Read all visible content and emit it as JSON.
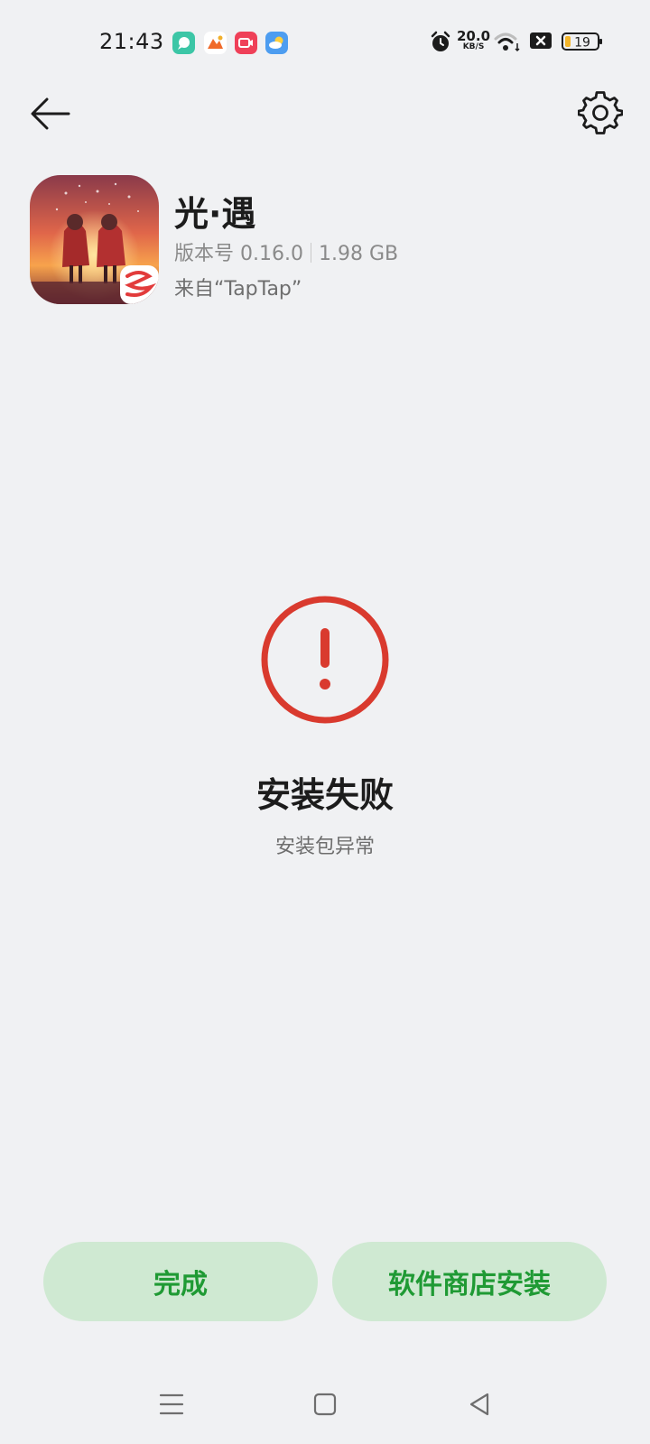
{
  "status_bar": {
    "time": "21:43",
    "notification_icons": [
      "chat-bubble-icon",
      "photo-gallery-icon",
      "video-recorder-icon",
      "weather-icon"
    ],
    "net_speed_value": "20.0",
    "net_speed_unit": "KB/S",
    "battery_level": "19",
    "icons": [
      "alarm-icon",
      "wifi-icon",
      "sim-off-icon",
      "battery-icon"
    ]
  },
  "header": {
    "back_icon": "arrow-left-icon",
    "settings_icon": "gear-icon"
  },
  "app": {
    "name": "光·遇",
    "version": "版本号 0.16.0",
    "size": "1.98 GB",
    "source": "来自“TapTap”"
  },
  "result": {
    "icon": "exclamation-circle-icon",
    "icon_color": "#d93a2e",
    "title": "安装失败",
    "subtitle": "安装包异常"
  },
  "actions": {
    "done_label": "完成",
    "store_install_label": "软件商店安装",
    "accent_color": "#1f9a34",
    "button_bg": "#cfe9d2"
  },
  "nav_bar": {
    "icons": [
      "menu-icon",
      "home-icon",
      "back-triangle-icon"
    ]
  }
}
